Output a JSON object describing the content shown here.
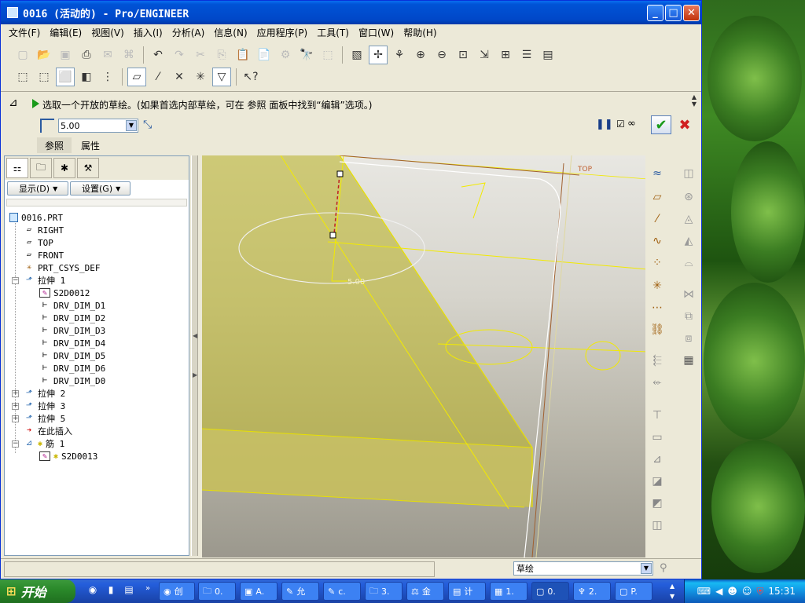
{
  "window": {
    "title": "0016 (活动的) - Pro/ENGINEER",
    "controls": {
      "minimize": "_",
      "maximize": "□",
      "close": "✕"
    }
  },
  "menu": [
    "文件(F)",
    "编辑(E)",
    "视图(V)",
    "插入(I)",
    "分析(A)",
    "信息(N)",
    "应用程序(P)",
    "工具(T)",
    "窗口(W)",
    "帮助(H)"
  ],
  "dashboard": {
    "message": "选取一个开放的草绘。(如果首选内部草绘，可在 参照 面板中找到“编辑”选项。)",
    "thickness_value": "5.00",
    "tabs": [
      "参照",
      "属性"
    ]
  },
  "model_tree": {
    "show_button": "显示(D)",
    "settings_button": "设置(G)",
    "items": [
      {
        "label": "0016.PRT",
        "icon": "part-icon"
      },
      {
        "label": "RIGHT",
        "icon": "datum-plane-icon"
      },
      {
        "label": "TOP",
        "icon": "datum-plane-icon"
      },
      {
        "label": "FRONT",
        "icon": "datum-plane-icon"
      },
      {
        "label": "PRT_CSYS_DEF",
        "icon": "csys-icon"
      },
      {
        "label": "拉伸 1",
        "icon": "extrude-icon"
      },
      {
        "label": "S2D0012",
        "icon": "sketch-icon"
      },
      {
        "label": "DRV_DIM_D1",
        "icon": "dim-icon"
      },
      {
        "label": "DRV_DIM_D2",
        "icon": "dim-icon"
      },
      {
        "label": "DRV_DIM_D3",
        "icon": "dim-icon"
      },
      {
        "label": "DRV_DIM_D4",
        "icon": "dim-icon"
      },
      {
        "label": "DRV_DIM_D5",
        "icon": "dim-icon"
      },
      {
        "label": "DRV_DIM_D6",
        "icon": "dim-icon"
      },
      {
        "label": "DRV_DIM_D0",
        "icon": "dim-icon"
      },
      {
        "label": "拉伸 2",
        "icon": "extrude-icon"
      },
      {
        "label": "拉伸 3",
        "icon": "extrude-icon"
      },
      {
        "label": "拉伸 5",
        "icon": "extrude-icon"
      },
      {
        "label": "在此插入",
        "icon": "insert-here-icon"
      },
      {
        "label": "筋 1",
        "icon": "rib-icon"
      },
      {
        "label": "S2D0013",
        "icon": "sketch-icon"
      }
    ]
  },
  "viewport": {
    "dim_label": "5.00",
    "datum_label": "TOP"
  },
  "statusbar": {
    "filter_value": "草绘"
  },
  "taskbar": {
    "start_label": "开始",
    "items": [
      "创",
      "0.",
      "A.",
      "允",
      "c.",
      "3.",
      "金",
      "计",
      "1.",
      "0.",
      "2.",
      "P."
    ],
    "clock": "15:31"
  },
  "colors": {
    "xp_blue": "#0053d6",
    "feature_yellow": "#d8d200",
    "desktop_green": "#3f8a24"
  }
}
